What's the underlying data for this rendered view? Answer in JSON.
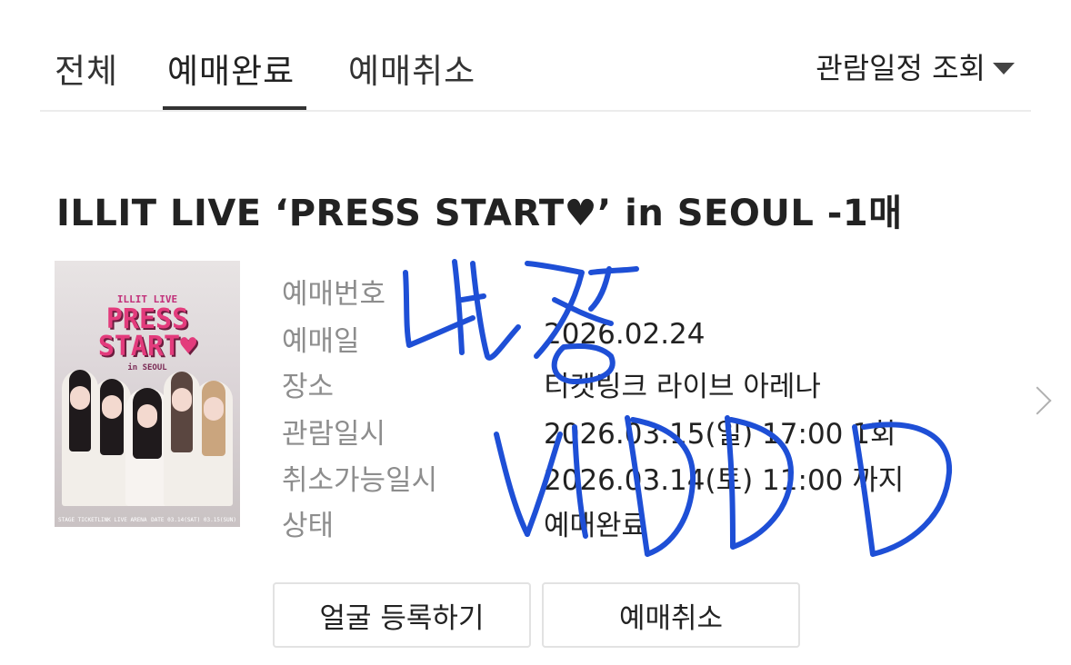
{
  "tabs": [
    {
      "label": "전체",
      "active": false
    },
    {
      "label": "예매완료",
      "active": true
    },
    {
      "label": "예매취소",
      "active": false
    }
  ],
  "schedule_filter": {
    "label": "관람일정 조회",
    "icon": "caret-down-icon"
  },
  "booking": {
    "title": "ILLIT LIVE ‘PRESS START♥’ in SEOUL  -1매",
    "poster": {
      "line1": "ILLIT LIVE",
      "line2a": "PRESS",
      "line2b": "START♥",
      "line3": "in SEOUL",
      "footer_left": "STAGE TICKETLINK LIVE ARENA",
      "footer_right": "DATE 03.14(SAT) 03.15(SUN)"
    },
    "fields": [
      {
        "label": "예매번호",
        "value": ""
      },
      {
        "label": "예매일",
        "value": "2026.02.24"
      },
      {
        "label": "장소",
        "value": "티켓링크 라이브 아레나"
      },
      {
        "label": "관람일시",
        "value": "2026.03.15(일) 17:00 1회"
      },
      {
        "label": "취소가능일시",
        "value": "2026.03.14(토) 11:00 까지"
      },
      {
        "label": "상태",
        "value": "예매완료"
      }
    ],
    "buttons": {
      "face_register": "얼굴 등록하기",
      "cancel": "예매취소"
    }
  },
  "colors": {
    "ink": "#222222",
    "label": "#8d8d8d",
    "scribble": "#1e4fd6",
    "poster_pink": "#e33b7c"
  }
}
